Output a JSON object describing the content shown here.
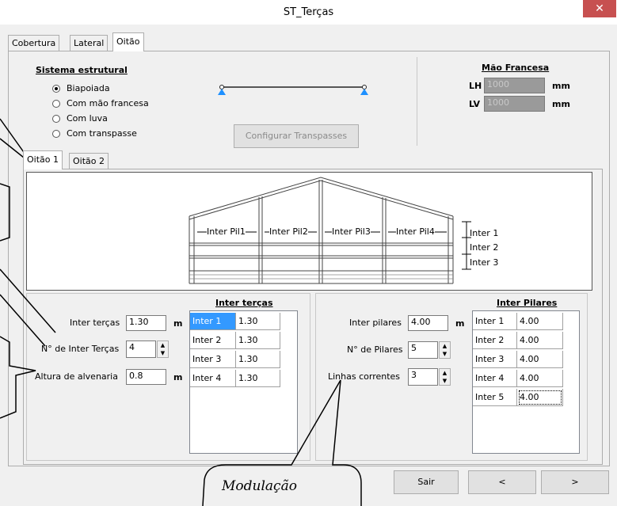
{
  "window": {
    "title": "ST_Terças",
    "close_glyph": "✕"
  },
  "tabs": [
    "Cobertura",
    "Lateral",
    "Oitão"
  ],
  "structural": {
    "heading": "Sistema estrutural",
    "options": [
      "Biapoiada",
      "Com mão francesa",
      "Com luva",
      "Com transpasse"
    ],
    "selected": "Biapoiada",
    "config_button": "Configurar Transpasses"
  },
  "mao_francesa": {
    "heading": "Mão Francesa",
    "lh_label": "LH",
    "lh_value": "1000",
    "lv_label": "LV",
    "lv_value": "1000",
    "unit": "mm"
  },
  "subtabs": [
    "Oitão 1",
    "Oitão 2"
  ],
  "drawing": {
    "pil_labels": [
      "Inter Pil1",
      "Inter Pil2",
      "Inter Pil3",
      "Inter Pil4"
    ],
    "inter_labels": [
      "Inter 1",
      "Inter 2",
      "Inter 3"
    ]
  },
  "tercas": {
    "inter_label": "Inter terças",
    "inter_value": "1.30",
    "unit": "m",
    "count_label": "N° de Inter Terças",
    "count_value": "4",
    "alvenaria_label": "Altura de alvenaria",
    "alvenaria_value": "0.8",
    "grid_title": "Inter terças",
    "rows": [
      [
        "Inter 1",
        "1.30"
      ],
      [
        "Inter 2",
        "1.30"
      ],
      [
        "Inter 3",
        "1.30"
      ],
      [
        "Inter 4",
        "1.30"
      ]
    ]
  },
  "pilares": {
    "inter_label": "Inter pilares",
    "inter_value": "4.00",
    "unit": "m",
    "count_label": "N° de Pilares",
    "count_value": "5",
    "linhas_label": "Linhas correntes",
    "linhas_value": "3",
    "grid_title": "Inter Pilares",
    "rows": [
      [
        "Inter 1",
        "4.00"
      ],
      [
        "Inter 2",
        "4.00"
      ],
      [
        "Inter 3",
        "4.00"
      ],
      [
        "Inter 4",
        "4.00"
      ],
      [
        "Inter 5",
        "4.00"
      ]
    ]
  },
  "footer": {
    "sair": "Sair",
    "prev": "<",
    "next": ">"
  },
  "callout_text": "Modulação",
  "colors": {
    "selected_cell": "#3399ff",
    "support": "#1e90ff",
    "close_bg": "#c75050"
  }
}
